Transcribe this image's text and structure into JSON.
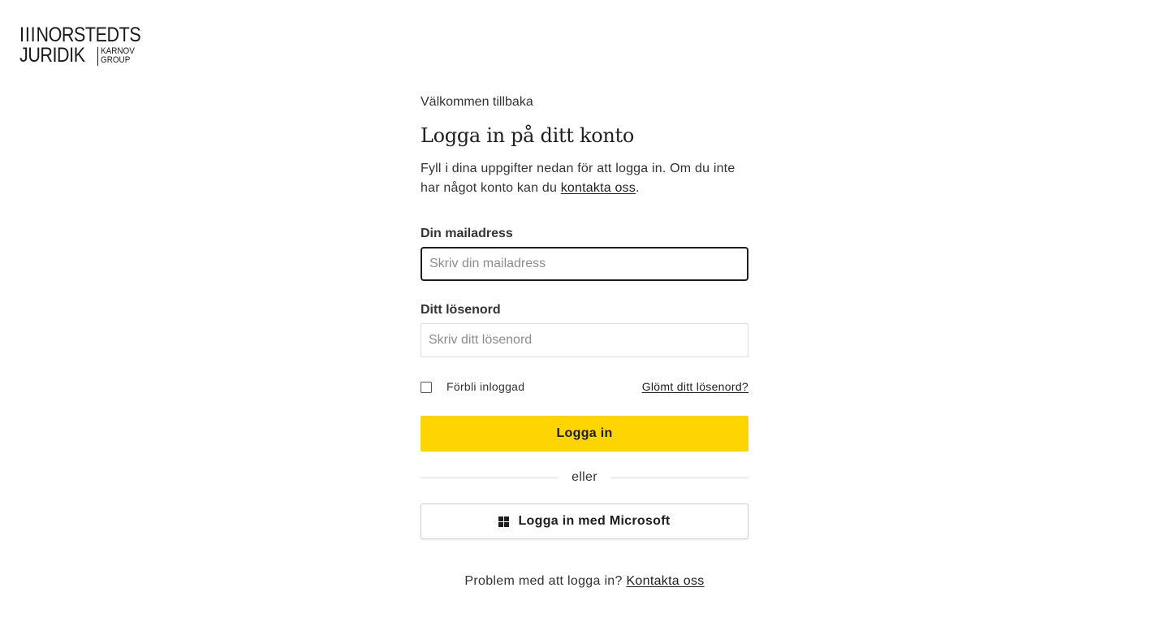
{
  "logo": {
    "line1_bars": "III",
    "line1_text": "NORSTEDTS",
    "line2_text": "JURIDIK",
    "group_line1": "KARNOV",
    "group_line2": "GROUP"
  },
  "login": {
    "welcome": "Välkommen tillbaka",
    "heading": "Logga in på ditt konto",
    "intro_text": "Fyll i dina uppgifter nedan för att logga in. Om du inte har något konto kan du ",
    "intro_link": "kontakta oss",
    "intro_end": ".",
    "email_label": "Din mailadress",
    "email_placeholder": "Skriv din mailadress",
    "email_value": "",
    "password_label": "Ditt lösenord",
    "password_placeholder": "Skriv ditt lösenord",
    "password_value": "",
    "remember_label": "Förbli inloggad",
    "remember_checked": false,
    "forgot_link": "Glömt ditt lösenord?",
    "login_button": "Logga in",
    "divider_text": "eller",
    "microsoft_button": "Logga in med Microsoft",
    "microsoft_icon": "windows-icon",
    "problem_text": "Problem med att logga in? ",
    "problem_link": "Kontakta oss"
  },
  "colors": {
    "primary_button": "#ffd500",
    "text": "#1e1e1e",
    "muted_text": "#333333",
    "input_border_focused": "#1e1e1e",
    "input_border": "#dcdcdc"
  }
}
